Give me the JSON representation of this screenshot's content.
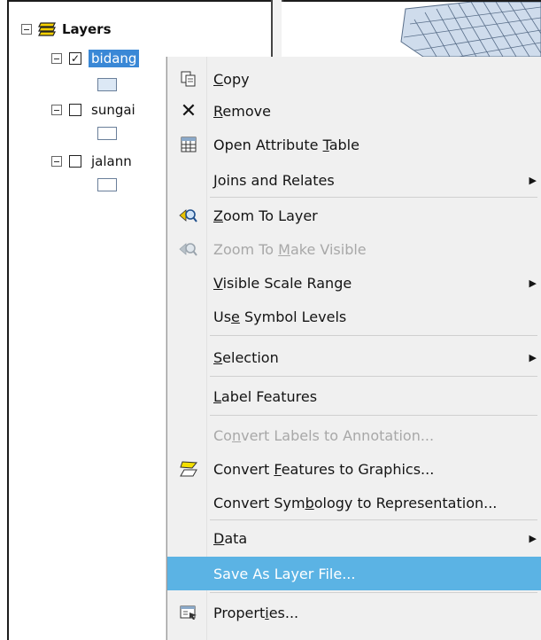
{
  "toc": {
    "root": {
      "label": "Layers",
      "expanded": true
    },
    "layers": [
      {
        "name": "bidang",
        "checked": true,
        "selected": true,
        "swatch_color": "#dce8f5"
      },
      {
        "name": "sungai",
        "checked": false,
        "selected": false,
        "swatch_color": "#ffffff"
      },
      {
        "name": "jalann",
        "checked": false,
        "selected": false,
        "swatch_color": "#ffffff"
      }
    ]
  },
  "context_menu": {
    "items": [
      {
        "label": "Copy",
        "mnemonic": "C",
        "icon": "copy-icon",
        "enabled": true
      },
      {
        "label": "Remove",
        "mnemonic": "R",
        "icon": "remove-icon",
        "enabled": true
      },
      {
        "label": "Open Attribute Table",
        "mnemonic": "T",
        "icon": "attribute-table-icon",
        "enabled": true
      },
      {
        "label": "Joins and Relates",
        "mnemonic": "J",
        "icon": "",
        "enabled": true,
        "submenu": true
      },
      {
        "label": "Zoom To Layer",
        "mnemonic": "Z",
        "icon": "zoom-to-layer-icon",
        "enabled": true
      },
      {
        "label": "Zoom To Make Visible",
        "mnemonic": "M",
        "icon": "zoom-to-make-visible-icon",
        "enabled": false
      },
      {
        "label": "Visible Scale Range",
        "mnemonic": "V",
        "icon": "",
        "enabled": true,
        "submenu": true
      },
      {
        "label": "Use Symbol Levels",
        "mnemonic": "e",
        "icon": "",
        "enabled": true
      },
      {
        "label": "Selection",
        "mnemonic": "S",
        "icon": "",
        "enabled": true,
        "submenu": true
      },
      {
        "label": "Label Features",
        "mnemonic": "L",
        "icon": "",
        "enabled": true
      },
      {
        "label": "Convert Labels to Annotation...",
        "mnemonic": "n",
        "icon": "",
        "enabled": false
      },
      {
        "label": "Convert Features to Graphics...",
        "mnemonic": "F",
        "icon": "convert-features-icon",
        "enabled": true
      },
      {
        "label": "Convert Symbology to Representation...",
        "mnemonic": "b",
        "icon": "",
        "enabled": true
      },
      {
        "label": "Data",
        "mnemonic": "D",
        "icon": "",
        "enabled": true,
        "submenu": true
      },
      {
        "label": "Save As Layer File...",
        "mnemonic": "",
        "icon": "",
        "enabled": true,
        "highlighted": true
      },
      {
        "label": "Properties...",
        "mnemonic": "i",
        "icon": "properties-icon",
        "enabled": true
      }
    ]
  },
  "colors": {
    "selection_blue": "#3a88d6",
    "menu_highlight": "#5bb3e4",
    "menu_background": "#f0f0f0",
    "disabled_text": "#a8a8a8"
  }
}
